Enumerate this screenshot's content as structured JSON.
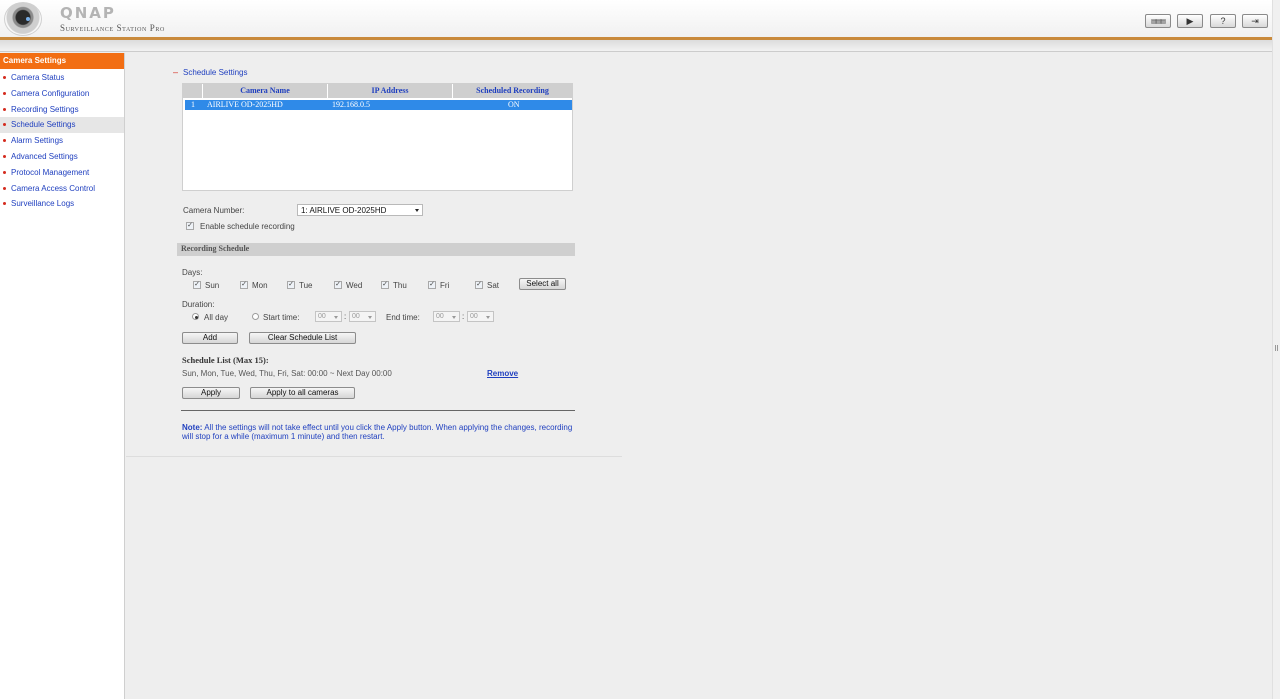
{
  "header": {
    "brand": "QNAP",
    "product": "Surveillance Station Pro",
    "buttons": [
      {
        "name": "monitor-button",
        "glyph": "▤▤▤"
      },
      {
        "name": "playback-button",
        "glyph": "▶"
      },
      {
        "name": "help-button",
        "glyph": "?"
      },
      {
        "name": "logout-button",
        "glyph": "⇥"
      }
    ]
  },
  "sidebar": {
    "title": "Camera Settings",
    "items": [
      {
        "label": "Camera Status"
      },
      {
        "label": "Camera Configuration"
      },
      {
        "label": "Recording Settings"
      },
      {
        "label": "Schedule Settings",
        "active": true
      },
      {
        "label": "Alarm Settings"
      },
      {
        "label": "Advanced Settings"
      },
      {
        "label": "Protocol Management"
      },
      {
        "label": "Camera Access Control"
      },
      {
        "label": "Surveillance Logs"
      }
    ]
  },
  "schedule": {
    "title": "Schedule Settings",
    "collapse_glyph": "–",
    "table": {
      "headers": [
        "Camera Name",
        "IP Address",
        "Scheduled Recording"
      ],
      "rows": [
        {
          "num": "1",
          "name": "AIRLIVE OD-2025HD",
          "ip": "192.168.0.5",
          "status": "ON"
        }
      ]
    },
    "camera_number_label": "Camera Number:",
    "camera_number_value": "1: AIRLIVE OD-2025HD",
    "enable_label": "Enable schedule recording",
    "enable_checked": true
  },
  "recording": {
    "section_title": "Recording Schedule",
    "days_label": "Days:",
    "days": [
      {
        "label": "Sun",
        "checked": true
      },
      {
        "label": "Mon",
        "checked": true
      },
      {
        "label": "Tue",
        "checked": true
      },
      {
        "label": "Wed",
        "checked": true
      },
      {
        "label": "Thu",
        "checked": true
      },
      {
        "label": "Fri",
        "checked": true
      },
      {
        "label": "Sat",
        "checked": true
      }
    ],
    "select_all_label": "Select all",
    "duration_label": "Duration:",
    "all_day_label": "All day",
    "start_time_label": "Start time:",
    "end_time_label": "End time:",
    "time_hour": "00",
    "time_minute": "00",
    "time_sep": ":",
    "add_label": "Add",
    "clear_label": "Clear Schedule List",
    "list_title": "Schedule List (Max 15):",
    "list_entries": [
      {
        "text": "Sun, Mon, Tue, Wed, Thu, Fri, Sat: 00:00 ~ Next Day 00:00",
        "remove_label": "Remove"
      }
    ],
    "apply_label": "Apply",
    "apply_all_label": "Apply to all cameras",
    "note_label": "Note:",
    "note_text": " All the settings will not take effect until you click the Apply button. When applying the changes, recording will stop for a while (maximum 1 minute) and then restart."
  }
}
